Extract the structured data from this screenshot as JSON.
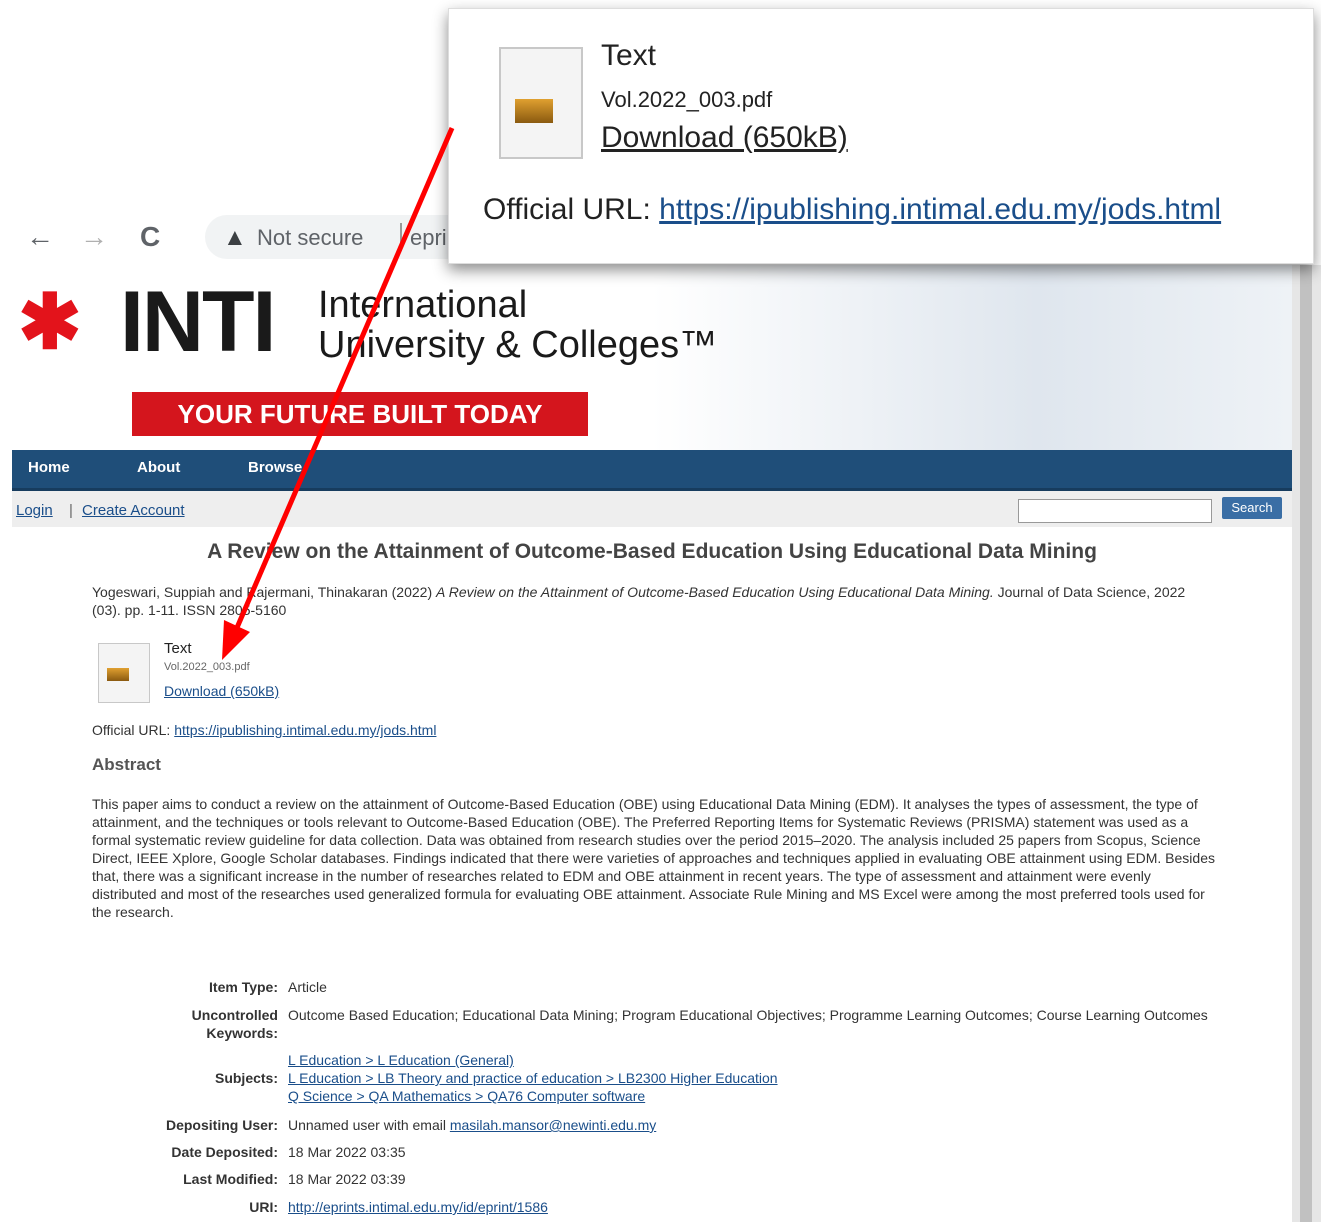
{
  "browser": {
    "back_icon": "←",
    "forward_icon": "→",
    "reload_icon": "C",
    "warning_icon": "▲",
    "security_text": "Not secure",
    "url_fragment": "epri"
  },
  "banner": {
    "logo_mark": "✱",
    "logo_text": "INTI",
    "line1": "International",
    "line2": "University & Colleges™",
    "tagline": "YOUR FUTURE BUILT TODAY"
  },
  "menu": [
    "Home",
    "About",
    "Browse"
  ],
  "userbar": {
    "login": "Login",
    "sep": "|",
    "create": "Create Account",
    "search_button": "Search"
  },
  "article": {
    "title": "A Review on the Attainment of Outcome-Based Education Using Educational Data Mining",
    "citation_authors": "Yogeswari, Suppiah and Rajermani, Thinakaran (2022)",
    "citation_title": "A Review on the Attainment of Outcome-Based Education Using Educational Data Mining.",
    "citation_rest": "Journal of Data Science, 2022 (03). pp. 1-11. ISSN 2805-5160",
    "doc_type": "Text",
    "doc_file": "Vol.2022_003.pdf",
    "doc_download": "Download (650kB)",
    "official_label": "Official URL:",
    "official_url": "https://ipublishing.intimal.edu.my/jods.html",
    "abstract_heading": "Abstract",
    "abstract": "This paper aims to conduct a review on the attainment of Outcome-Based Education (OBE) using Educational Data Mining (EDM). It analyses the types of assessment, the type of attainment, and the techniques or tools relevant to Outcome-Based Education (OBE). The Preferred Reporting Items for Systematic Reviews (PRISMA) statement was used as a formal systematic review guideline for data collection. Data was obtained from research studies over the period 2015–2020. The analysis included 25 papers from Scopus, Science Direct, IEEE Xplore, Google Scholar databases. Findings indicated that there were varieties of approaches and techniques applied in evaluating OBE attainment using EDM. Besides that, there was a significant increase in the number of researches related to EDM and OBE attainment in recent years. The type of assessment and attainment were evenly distributed and most of the researches used generalized formula for evaluating OBE attainment. Associate Rule Mining and MS Excel were among the most preferred tools used for the research."
  },
  "meta": {
    "item_type_label": "Item Type:",
    "item_type": "Article",
    "keywords_label_1": "Uncontrolled",
    "keywords_label_2": "Keywords:",
    "keywords": "Outcome Based Education; Educational Data Mining; Program Educational Objectives; Programme Learning Outcomes; Course Learning Outcomes",
    "subjects_label": "Subjects:",
    "subject_1": "L Education > L Education (General)",
    "subject_2": "L Education > LB Theory and practice of education > LB2300 Higher Education",
    "subject_3": "Q Science > QA Mathematics > QA76 Computer software",
    "depositing_label": "Depositing User:",
    "depositing_text": "Unnamed user with email",
    "depositing_email": "masilah.mansor@newinti.edu.my",
    "date_deposited_label": "Date Deposited:",
    "date_deposited": "18 Mar 2022 03:35",
    "last_modified_label": "Last Modified:",
    "last_modified": "18 Mar 2022 03:39",
    "uri_label": "URI:",
    "uri": "http://eprints.intimal.edu.my/id/eprint/1586"
  },
  "callout": {
    "doc_type": "Text",
    "doc_file": "Vol.2022_003.pdf",
    "doc_download": "Download (650kB)",
    "official_label": "Official URL:",
    "official_url": "https://ipublishing.intimal.edu.my/jods.html"
  },
  "colors": {
    "menubar": "#1f4e79",
    "tagline": "#d4151d",
    "arrow": "#ff0000",
    "link": "#1a4e8a"
  }
}
